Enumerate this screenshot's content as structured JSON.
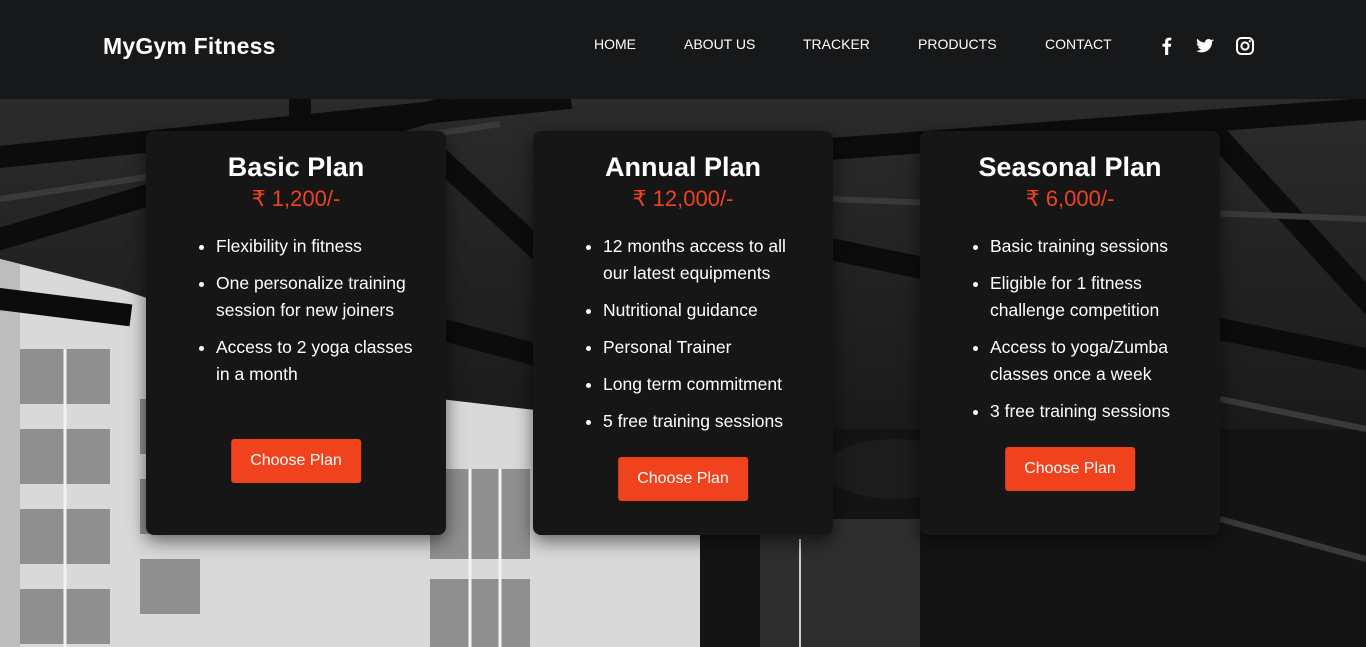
{
  "brand": "MyGym Fitness",
  "nav": [
    {
      "label": "HOME"
    },
    {
      "label": "ABOUT US"
    },
    {
      "label": "TRACKER"
    },
    {
      "label": "PRODUCTS"
    },
    {
      "label": "CONTACT"
    }
  ],
  "social": [
    {
      "icon": "facebook-icon"
    },
    {
      "icon": "twitter-icon"
    },
    {
      "icon": "instagram-icon"
    }
  ],
  "colors": {
    "accent": "#f0421c",
    "navbar": "#17181a",
    "card": "#161616"
  },
  "plans": [
    {
      "title": "Basic Plan",
      "price": "₹ 1,200/-",
      "features": [
        "Flexibility in fitness",
        "One personalize training session for new joiners",
        "Access to 2 yoga classes in a month"
      ],
      "button": "Choose Plan"
    },
    {
      "title": "Annual Plan",
      "price": "₹ 12,000/-",
      "features": [
        "12 months access to all our latest equipments",
        "Nutritional guidance",
        "Personal Trainer",
        "Long term commitment",
        "5 free training sessions"
      ],
      "button": "Choose Plan"
    },
    {
      "title": "Seasonal Plan",
      "price": "₹ 6,000/-",
      "features": [
        "Basic training sessions",
        "Eligible for 1 fitness challenge competition",
        "Access to yoga/Zumba classes once a week",
        "3 free training sessions"
      ],
      "button": "Choose Plan"
    }
  ]
}
